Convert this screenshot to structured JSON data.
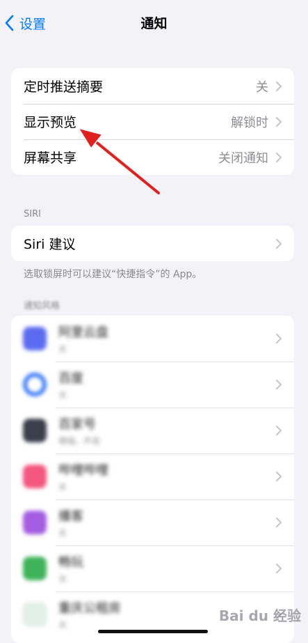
{
  "nav": {
    "back_label": "设置",
    "title": "通知"
  },
  "general_group": [
    {
      "label": "定时推送摘要",
      "value": "关"
    },
    {
      "label": "显示预览",
      "value": "解锁时"
    },
    {
      "label": "屏幕共享",
      "value": "关闭通知"
    }
  ],
  "siri": {
    "header": "SIRI",
    "row_label": "Siri 建议",
    "footer": "选取锁屏时可以建议“快捷指令”的 App。"
  },
  "app_section": {
    "header": "通知风格",
    "apps": [
      {
        "name": "阿里云盘",
        "sub": "关",
        "icon_color": "#5b6cf0"
      },
      {
        "name": "百度",
        "sub": "关",
        "icon_color": "#3a7af5"
      },
      {
        "name": "百家号",
        "sub": "横幅，声音",
        "icon_color": "#3b3f4c"
      },
      {
        "name": "哔哩哔哩",
        "sub": "关",
        "icon_color": "#f2577f"
      },
      {
        "name": "播客",
        "sub": "关",
        "icon_color": "#a45de0"
      },
      {
        "name": "畅玩",
        "sub": "关",
        "icon_color": "#3fb35a"
      },
      {
        "name": "重庆公租房",
        "sub": "关",
        "icon_color": "#e3f0e8"
      }
    ]
  },
  "watermark": "Bai du 经验",
  "colors": {
    "accent": "#007aff",
    "annotation_arrow": "#e0201f"
  }
}
